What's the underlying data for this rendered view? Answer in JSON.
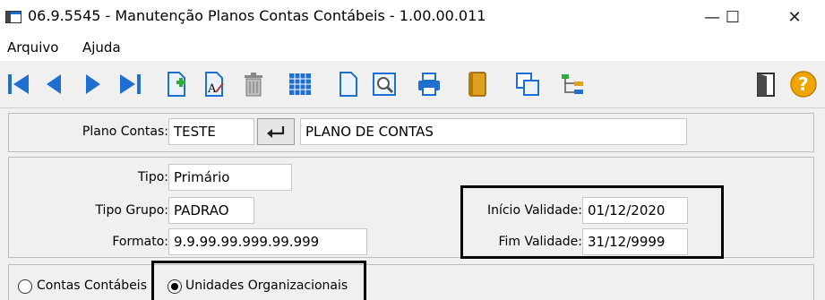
{
  "window": {
    "title": "06.9.5545 - Manutenção Planos Contas Contábeis - 1.00.00.011",
    "minimize": "—",
    "maximize": "☐",
    "close": "✕"
  },
  "menu": {
    "items": [
      "Arquivo",
      "Ajuda"
    ]
  },
  "toolbar": {
    "buttons": [
      "first-record",
      "previous-record",
      "next-record",
      "last-record",
      "new-record",
      "edit-record",
      "delete-trash",
      "grid-calendar",
      "blank-document",
      "print-preview",
      "printer",
      "book",
      "copy-windows",
      "tree-structure",
      "exit-door",
      "help"
    ]
  },
  "plano": {
    "label": "Plano Contas:",
    "code": "TESTE",
    "name": "PLANO DE CONTAS"
  },
  "details": {
    "tipo_label": "Tipo:",
    "tipo": "Primário",
    "tipo_grupo_label": "Tipo Grupo:",
    "tipo_grupo": "PADRAO",
    "formato_label": "Formato:",
    "formato": "9.9.99.99.999.99.999",
    "inicio_label": "Início Validade:",
    "inicio": "01/12/2020",
    "fim_label": "Fim Validade:",
    "fim": "31/12/9999"
  },
  "options": {
    "contas_label": "Contas Contábeis",
    "unidades_label": "Unidades Organizacionais",
    "selected": "Unidades Organizacionais"
  },
  "colors": {
    "accent_blue": "#1e6fd0",
    "toolbar_bg": "#f0f0f0"
  }
}
